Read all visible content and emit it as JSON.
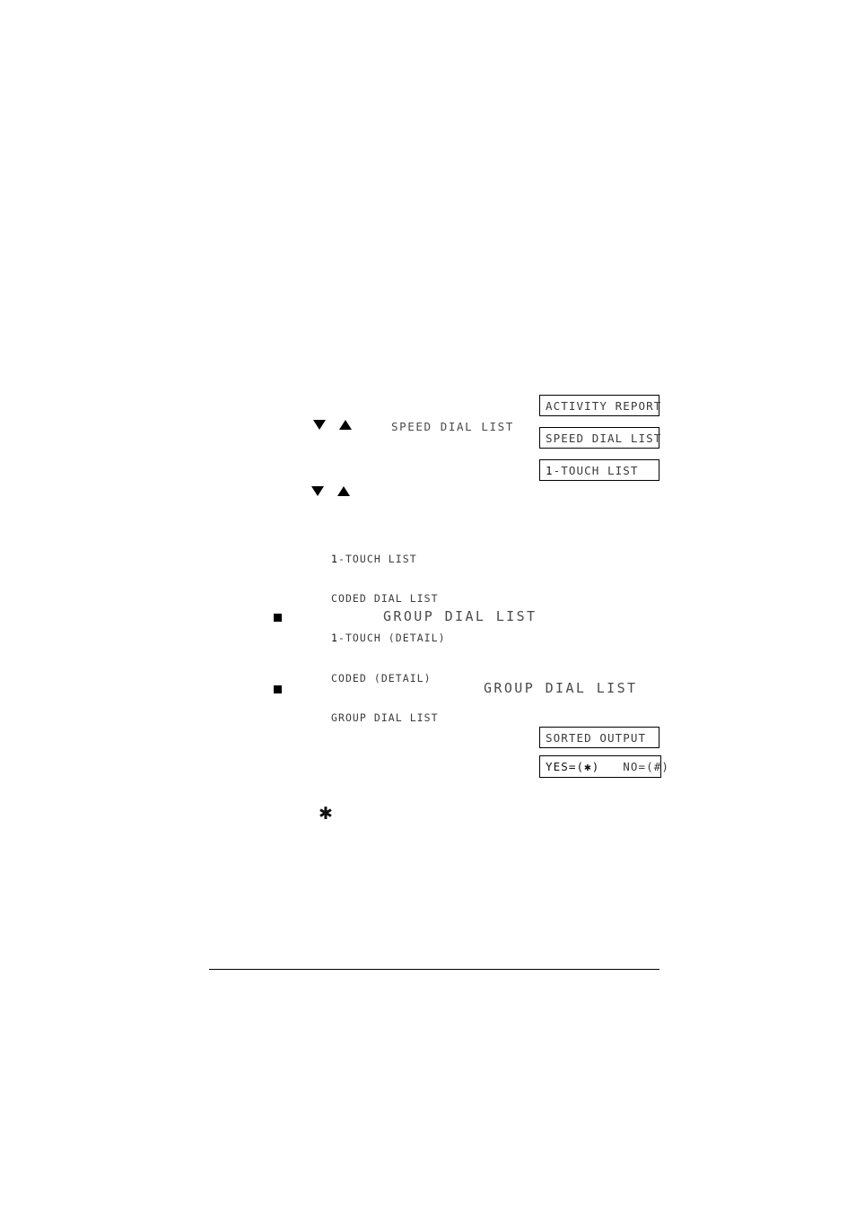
{
  "lcd_displays": [
    {
      "text": "ACTIVITY REPORT"
    },
    {
      "text": "SPEED DIAL LIST"
    },
    {
      "lead": "1",
      "rest": "-TOUCH LIST"
    },
    {
      "text": "SORTED OUTPUT"
    },
    {
      "lead": "YES=(✱)",
      "rest": "   NO=(#)"
    }
  ],
  "captions": {
    "speed_dial_list": "SPEED DIAL LIST",
    "group_dial_list_a": "GROUP DIAL LIST",
    "group_dial_list_b": "GROUP DIAL LIST"
  },
  "option_list": [
    {
      "lead": "1",
      "rest": "-TOUCH LIST"
    },
    {
      "lead": "",
      "rest": "CODED DIAL LIST"
    },
    {
      "lead": "1",
      "rest": "-TOUCH (DETAIL)"
    },
    {
      "lead": "",
      "rest": "CODED (DETAIL)"
    },
    {
      "lead": "",
      "rest": "GROUP DIAL LIST"
    }
  ],
  "asterisk_mark": "✱",
  "colors": {
    "ink": "#000000",
    "lcd_text": "#3a3a3a",
    "caption_text": "#4a4a4a",
    "page_background": "#ffffff"
  }
}
